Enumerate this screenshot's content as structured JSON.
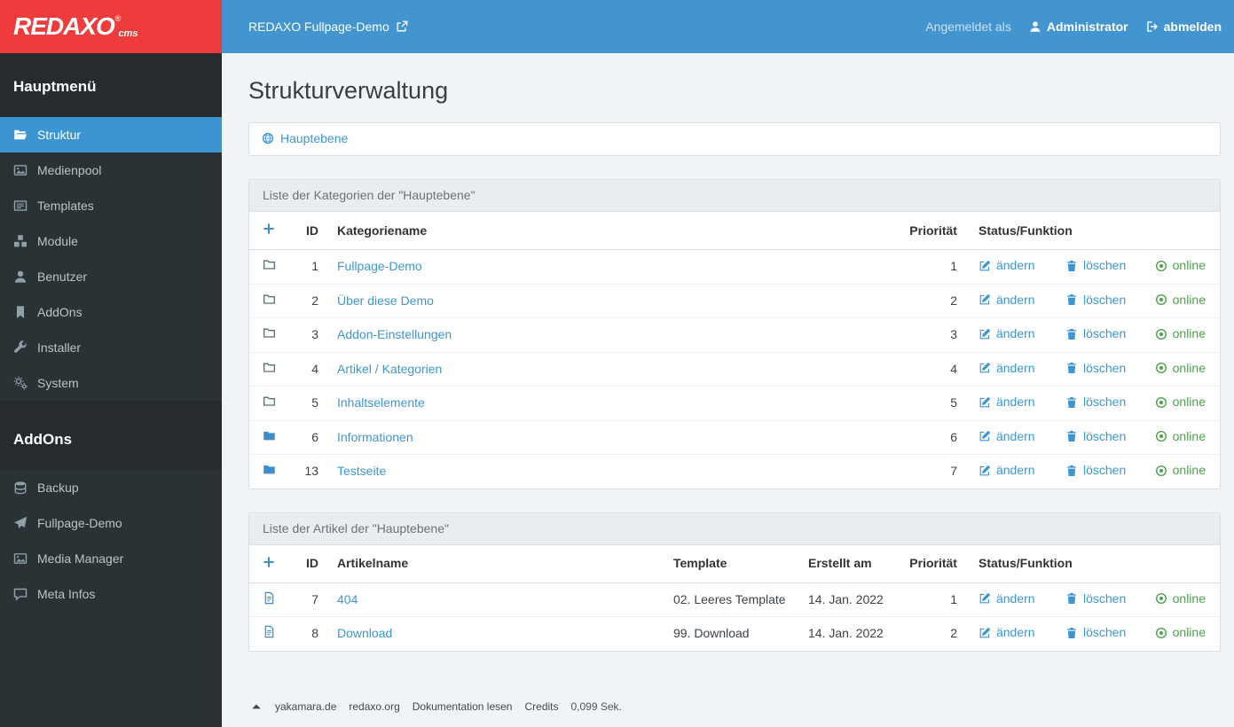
{
  "colors": {
    "accent_blue": "#4295ce",
    "brand_red": "#ee3b3b",
    "sidebar_bg": "#2b3236",
    "link_blue": "#3d96d2",
    "online_green": "#4aa44a"
  },
  "topbar": {
    "logo_text": "REDAXO",
    "logo_reg": "®",
    "logo_sub": "cms",
    "site_link": "REDAXO Fullpage-Demo",
    "logged_in_label": "Angemeldet als",
    "username": "Administrator",
    "logout_label": "abmelden"
  },
  "sidebar": {
    "main_header": "Hauptmenü",
    "items": [
      {
        "label": "Struktur"
      },
      {
        "label": "Medienpool"
      },
      {
        "label": "Templates"
      },
      {
        "label": "Module"
      },
      {
        "label": "Benutzer"
      },
      {
        "label": "AddOns"
      },
      {
        "label": "Installer"
      },
      {
        "label": "System"
      }
    ],
    "addons_header": "AddOns",
    "addon_items": [
      {
        "label": "Backup"
      },
      {
        "label": "Fullpage-Demo"
      },
      {
        "label": "Media Manager"
      },
      {
        "label": "Meta Infos"
      }
    ]
  },
  "main": {
    "page_title": "Strukturverwaltung",
    "breadcrumb": {
      "label": "Hauptebene"
    },
    "actions": {
      "edit": "ändern",
      "delete": "löschen",
      "online": "online"
    },
    "categories_panel": {
      "title": "Liste der Kategorien der \"Hauptebene\"",
      "columns": {
        "id": "ID",
        "name": "Kategoriename",
        "priority": "Priorität",
        "status": "Status/Funktion"
      },
      "rows": [
        {
          "id": "1",
          "name": "Fullpage-Demo",
          "priority": "1"
        },
        {
          "id": "2",
          "name": "Über diese Demo",
          "priority": "2"
        },
        {
          "id": "3",
          "name": "Addon-Einstellungen",
          "priority": "3"
        },
        {
          "id": "4",
          "name": "Artikel / Kategorien",
          "priority": "4"
        },
        {
          "id": "5",
          "name": "Inhaltselemente",
          "priority": "5"
        },
        {
          "id": "6",
          "name": "Informationen",
          "priority": "6"
        },
        {
          "id": "13",
          "name": "Testseite",
          "priority": "7"
        }
      ]
    },
    "articles_panel": {
      "title": "Liste der Artikel der \"Hauptebene\"",
      "columns": {
        "id": "ID",
        "name": "Artikelname",
        "template": "Template",
        "created": "Erstellt am",
        "priority": "Priorität",
        "status": "Status/Funktion"
      },
      "rows": [
        {
          "id": "7",
          "name": "404",
          "template": "02. Leeres Template",
          "created": "14. Jan. 2022",
          "priority": "1"
        },
        {
          "id": "8",
          "name": "Download",
          "template": "99. Download",
          "created": "14. Jan. 2022",
          "priority": "2"
        }
      ]
    },
    "footer": {
      "links": [
        "yakamara.de",
        "redaxo.org",
        "Dokumentation lesen",
        "Credits"
      ],
      "duration": "0,099 Sek."
    }
  }
}
